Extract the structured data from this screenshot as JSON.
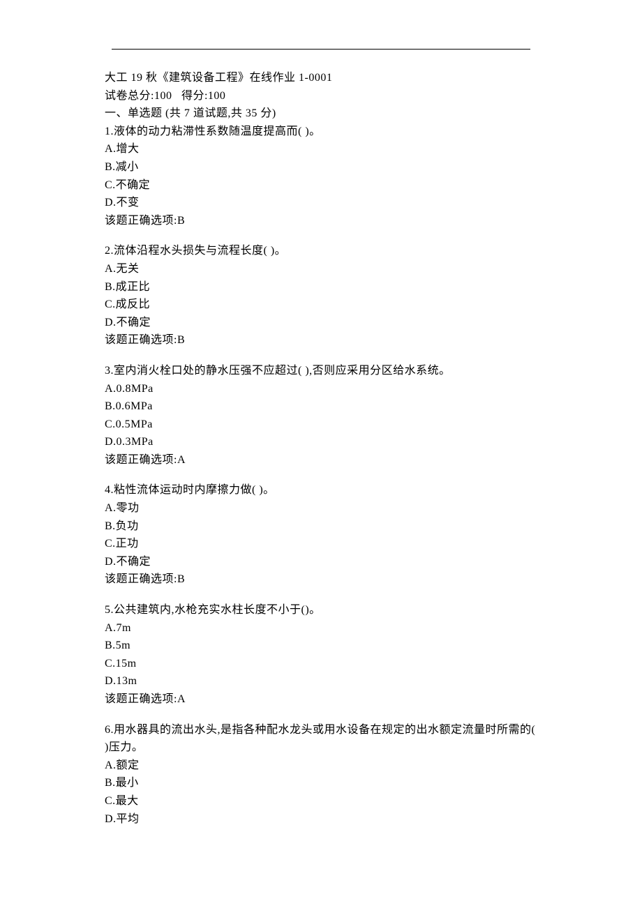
{
  "header": {
    "title": "大工 19 秋《建筑设备工程》在线作业 1-0001",
    "score_line": "试卷总分:100   得分:100",
    "section_title": "一、单选题 (共 7 道试题,共 35 分)"
  },
  "questions": [
    {
      "stem": "1.液体的动力粘滞性系数随温度提高而( )。",
      "options": [
        "A.增大",
        "B.减小",
        "C.不确定",
        "D.不变"
      ],
      "answer_line": "该题正确选项:B"
    },
    {
      "stem": "2.流体沿程水头损失与流程长度( )。",
      "options": [
        "A.无关",
        "B.成正比",
        "C.成反比",
        "D.不确定"
      ],
      "answer_line": "该题正确选项:B"
    },
    {
      "stem": "3.室内消火栓口处的静水压强不应超过( ),否则应采用分区给水系统。",
      "options": [
        "A.0.8MPa",
        "B.0.6MPa",
        "C.0.5MPa",
        "D.0.3MPa"
      ],
      "answer_line": "该题正确选项:A"
    },
    {
      "stem": "4.粘性流体运动时内摩擦力做( )。",
      "options": [
        "A.零功",
        "B.负功",
        "C.正功",
        "D.不确定"
      ],
      "answer_line": "该题正确选项:B"
    },
    {
      "stem": "5.公共建筑内,水枪充实水柱长度不小于()。",
      "options": [
        "A.7m",
        "B.5m",
        "C.15m",
        "D.13m"
      ],
      "answer_line": "该题正确选项:A"
    },
    {
      "stem": "6.用水器具的流出水头,是指各种配水龙头或用水设备在规定的出水额定流量时所需的( )压力。",
      "options": [
        "A.额定",
        "B.最小",
        "C.最大",
        "D.平均"
      ],
      "answer_line": ""
    }
  ]
}
